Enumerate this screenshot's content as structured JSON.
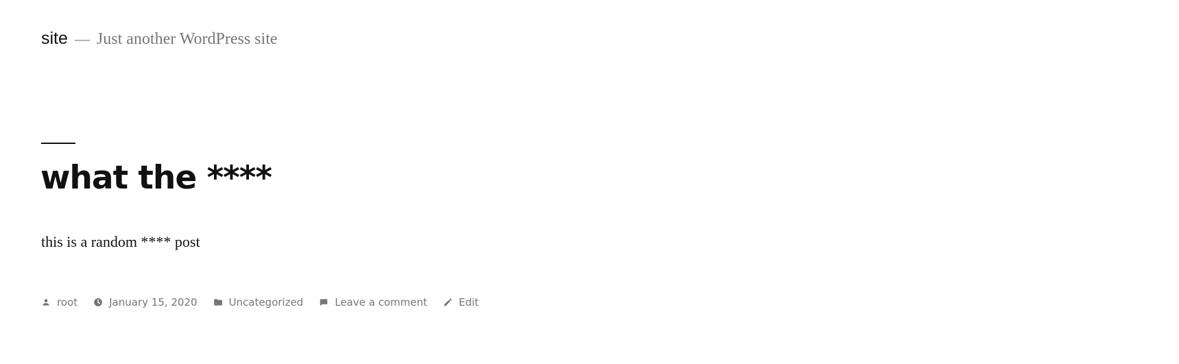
{
  "header": {
    "site_title": "site",
    "separator": "—",
    "tagline": "Just another WordPress site"
  },
  "post": {
    "title": "what the ****",
    "content": "this is a random **** post"
  },
  "meta": {
    "author": "root",
    "date": "January 15, 2020",
    "category": "Uncategorized",
    "comments": "Leave a comment",
    "edit": "Edit"
  },
  "icons": {
    "author": "person-icon",
    "date": "clock-icon",
    "category": "folder-icon",
    "comments": "comment-icon",
    "edit": "pencil-icon"
  },
  "colors": {
    "text": "#111111",
    "muted": "#767676",
    "background": "#ffffff"
  }
}
